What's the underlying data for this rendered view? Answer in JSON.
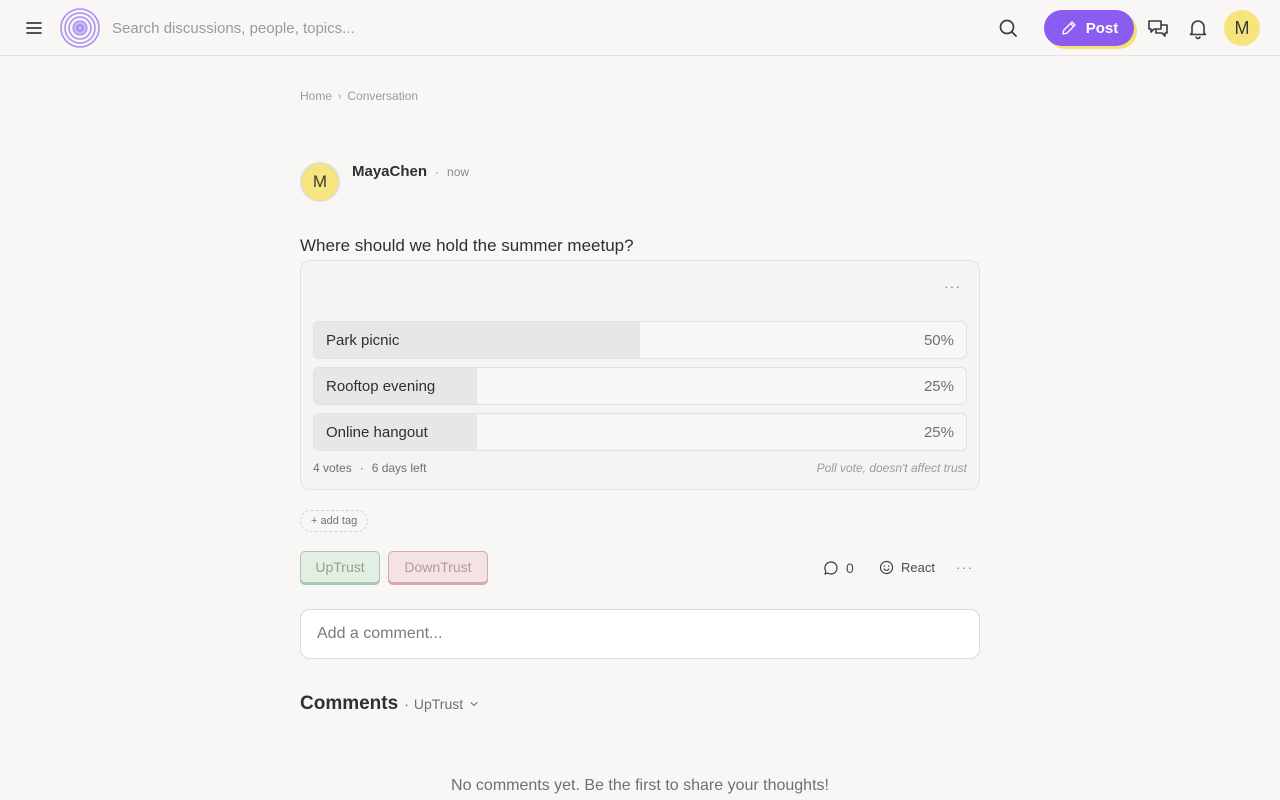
{
  "header": {
    "search_placeholder": "Search discussions, people, topics...",
    "post_label": "Post",
    "avatar_initial": "M"
  },
  "breadcrumb": {
    "home": "Home",
    "current": "Conversation"
  },
  "post": {
    "author": "MayaChen",
    "author_initial": "M",
    "separator": "·",
    "time": "now",
    "title": "Where should we hold the summer meetup?"
  },
  "poll": {
    "more_label": "···",
    "options": [
      {
        "label": "Park picnic",
        "percent_label": "50%",
        "fraction": 0.5
      },
      {
        "label": "Rooftop evening",
        "percent_label": "25%",
        "fraction": 0.25
      },
      {
        "label": "Online hangout",
        "percent_label": "25%",
        "fraction": 0.25
      }
    ],
    "votes": "4 votes",
    "dot": "·",
    "time_left": "6 days left",
    "note": "Poll vote, doesn't affect trust"
  },
  "tags": {
    "add_label": "+ add tag"
  },
  "actions": {
    "uptrust_label": "UpTrust",
    "downtrust_label": "DownTrust",
    "comment_count": "0",
    "react_label": "React",
    "more_label": "···"
  },
  "comments": {
    "input_placeholder": "Add a comment...",
    "title": "Comments",
    "sort_prefix": "·",
    "sort_value": "UpTrust",
    "empty_message": "No comments yet. Be the first to share your thoughts!"
  },
  "colors": {
    "accent": "#8a5cf0",
    "avatar": "#f8e47c",
    "uptrust_bg": "#e4efe4",
    "downtrust_bg": "#f3e3e3",
    "poll_fill": "#e8e7e5"
  },
  "icons": {
    "menu": "menu-icon",
    "logo": "logo-icon",
    "search": "search-icon",
    "post": "pencil-icon",
    "messages": "chat-bubbles-icon",
    "notifications": "bell-icon",
    "comment": "comment-bubble-icon",
    "react": "smiley-icon",
    "sort": "chevron-down-icon"
  }
}
